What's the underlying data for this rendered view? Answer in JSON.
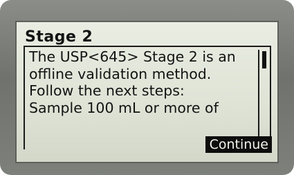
{
  "screen": {
    "title": "Stage 2",
    "message_lines": [
      "The USP<645> Stage 2 is an",
      "offline validation method.",
      "Follow the next steps:",
      "Sample 100 mL or more of"
    ],
    "scroll_fraction_visible": 0.18
  },
  "actions": {
    "continue_label": "Continue"
  },
  "colors": {
    "lcd_background": "#e3e7da",
    "lcd_text": "#131313",
    "bezel": "#7a7d78",
    "highlight": "#0d0d0d"
  }
}
